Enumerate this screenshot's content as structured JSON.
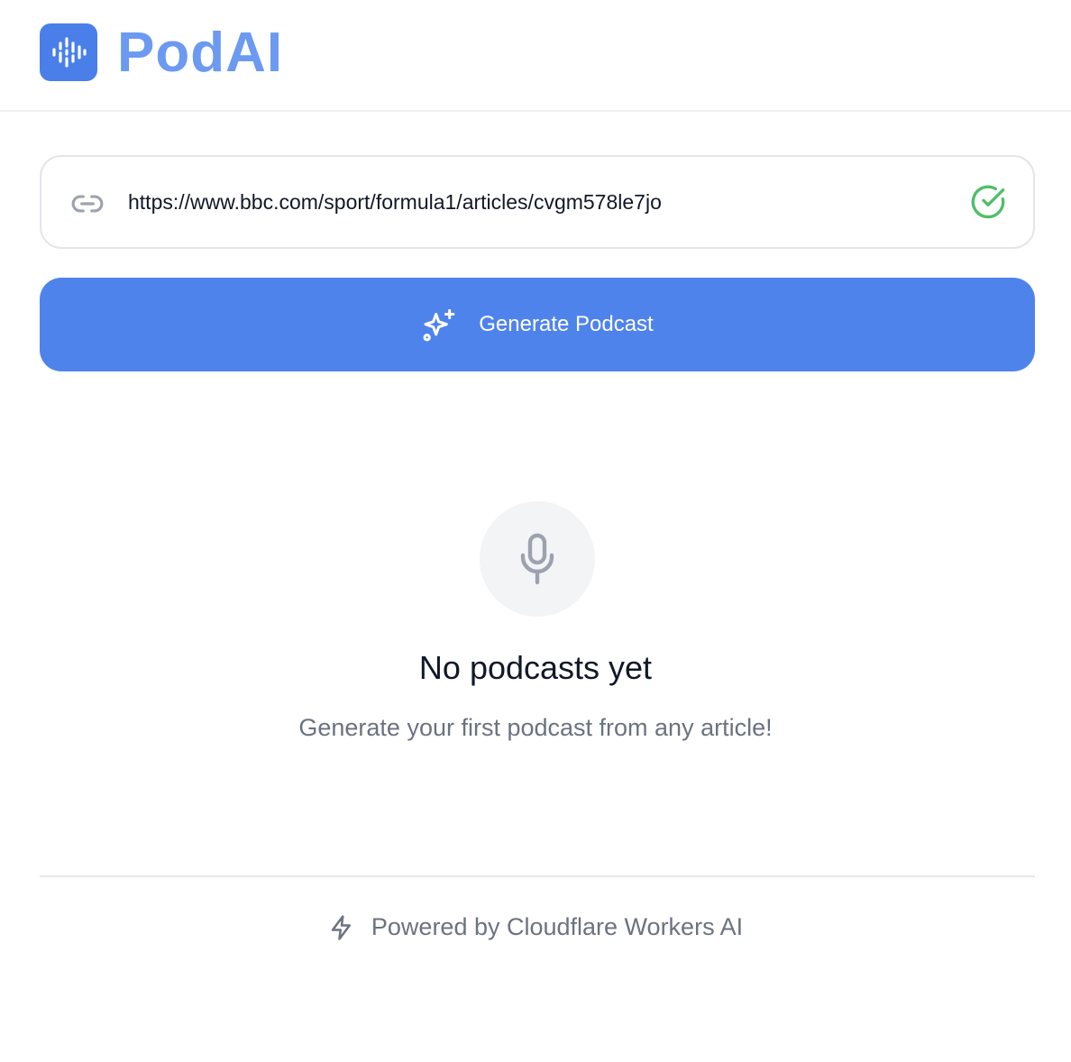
{
  "header": {
    "brand_name": "PodAI",
    "logo_icon": "audio-waveform-icon",
    "brand_color": "#4a7fea"
  },
  "url_input": {
    "value": "https://www.bbc.com/sport/formula1/articles/cvgm578le7jo",
    "leading_icon": "link-icon",
    "status_icon": "check-circle-icon",
    "status_color": "#4fbf68"
  },
  "generate_button": {
    "label": "Generate Podcast",
    "icon": "sparkles-icon",
    "color": "#4f83ec"
  },
  "empty_state": {
    "icon": "microphone-icon",
    "title": "No podcasts yet",
    "subtitle": "Generate your first podcast from any article!"
  },
  "footer": {
    "icon": "bolt-icon",
    "text": "Powered by Cloudflare Workers AI"
  }
}
